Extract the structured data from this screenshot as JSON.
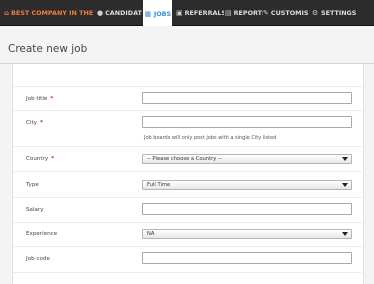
{
  "nav": {
    "brand": "BEST COMPANY IN THE WO",
    "items": [
      {
        "label": "CANDIDATES",
        "icon": "users-icon"
      },
      {
        "label": "JOBS",
        "icon": "briefcase-icon"
      },
      {
        "label": "REFERRALS",
        "icon": "gift-icon"
      },
      {
        "label": "REPORTS",
        "icon": "chart-icon"
      },
      {
        "label": "CUSTOMISE",
        "icon": "pencil-icon"
      },
      {
        "label": "SETTINGS",
        "icon": "gear-icon"
      }
    ],
    "active_index": 1
  },
  "page": {
    "title": "Create new job"
  },
  "form": {
    "job_title": {
      "label": "Job title",
      "required": "*",
      "value": ""
    },
    "city": {
      "label": "City",
      "required": "*",
      "value": "",
      "help": "Job boards will only post jobs with a single City listed"
    },
    "country": {
      "label": "Country",
      "required": "*",
      "selected": "-- Please choose a Country --"
    },
    "type": {
      "label": "Type",
      "selected": "Full Time"
    },
    "salary": {
      "label": "Salary",
      "value": ""
    },
    "experience": {
      "label": "Experience",
      "selected": "NA"
    },
    "job_code": {
      "label": "Job code",
      "value": ""
    }
  },
  "colors": {
    "nav_bg": "#2c2c2c",
    "brand": "#e9803a",
    "active_tab": "#3a8fd6",
    "required": "#c62828"
  }
}
